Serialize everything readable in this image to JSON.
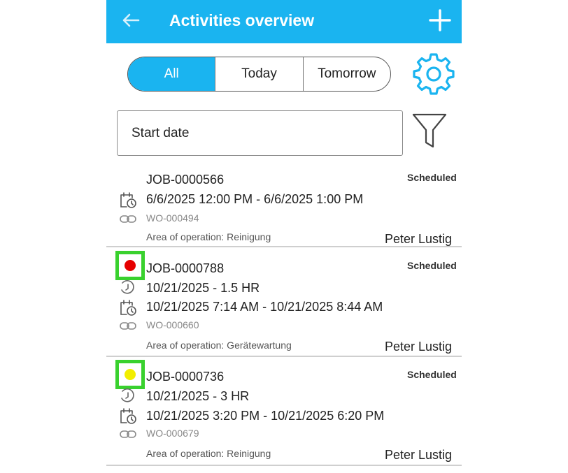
{
  "header": {
    "title": "Activities overview",
    "background": "#1ab4f0"
  },
  "tabs": [
    {
      "label": "All",
      "active": true
    },
    {
      "label": "Today",
      "active": false
    },
    {
      "label": "Tomorrow",
      "active": false
    }
  ],
  "filter": {
    "start_date_label": "Start date"
  },
  "activities": [
    {
      "job": "JOB-0000566",
      "status": "Scheduled",
      "time_range": "6/6/2025 12:00 PM - 6/6/2025 1:00 PM",
      "work_order": "WO-000494",
      "area": "Area of operation: Reinigung",
      "assignee": "Peter Lustig"
    },
    {
      "job": "JOB-0000788",
      "status": "Scheduled",
      "priority_color": "#e60000",
      "duration": "10/21/2025 - 1.5 HR",
      "time_range": "10/21/2025 7:14 AM - 10/21/2025 8:44 AM",
      "work_order": "WO-000660",
      "area": "Area of operation: Gerätewartung",
      "assignee": "Peter Lustig"
    },
    {
      "job": "JOB-0000736",
      "status": "Scheduled",
      "priority_color": "#f2ee00",
      "duration": "10/21/2025 - 3 HR",
      "time_range": "10/21/2025 3:20 PM - 10/21/2025 6:20 PM",
      "work_order": "WO-000679",
      "area": "Area of operation: Reinigung",
      "assignee": "Peter Lustig"
    }
  ],
  "colors": {
    "accent": "#1ab4f0",
    "highlight": "#39d12e"
  }
}
